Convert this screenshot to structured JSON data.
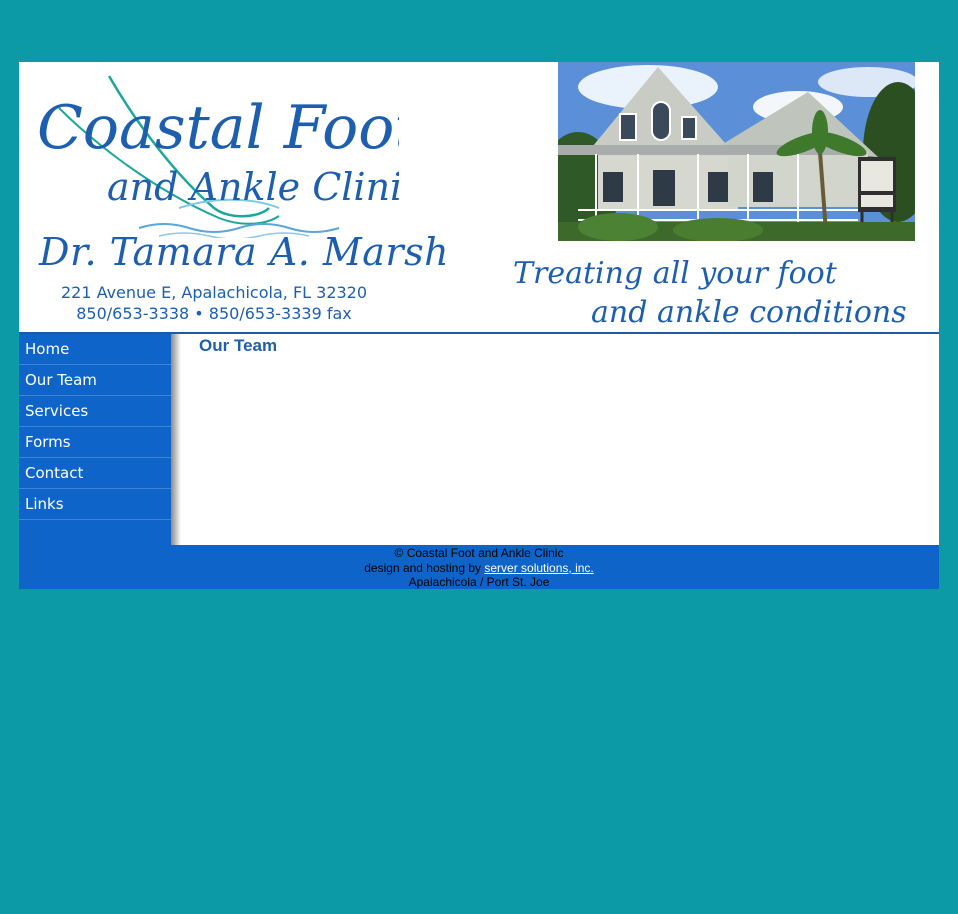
{
  "header": {
    "logo": {
      "line1": "Coastal Foot",
      "line2": "and Ankle Clinic"
    },
    "doctor_name": "Dr. Tamara A. Marsh",
    "address": "221 Avenue E, Apalachicola, FL 32320",
    "phones": "850/653-3338 • 850/653-3339 fax",
    "tagline_1": "Treating all your foot",
    "tagline_2": "and ankle conditions"
  },
  "nav": {
    "items": [
      {
        "label": "Home"
      },
      {
        "label": "Our Team"
      },
      {
        "label": "Services"
      },
      {
        "label": "Forms"
      },
      {
        "label": "Contact"
      },
      {
        "label": "Links"
      }
    ]
  },
  "main": {
    "title": "Our Team"
  },
  "footer": {
    "copyright": "© Coastal Foot and Ankle Clinic",
    "credit_prefix": "design and hosting by",
    "credit_link": "server solutions, inc.",
    "locations": "Apalachicola / Port St. Joe"
  },
  "colors": {
    "background": "#0b9aa6",
    "brand_blue": "#0e64c8",
    "text_blue": "#1d5fae"
  }
}
